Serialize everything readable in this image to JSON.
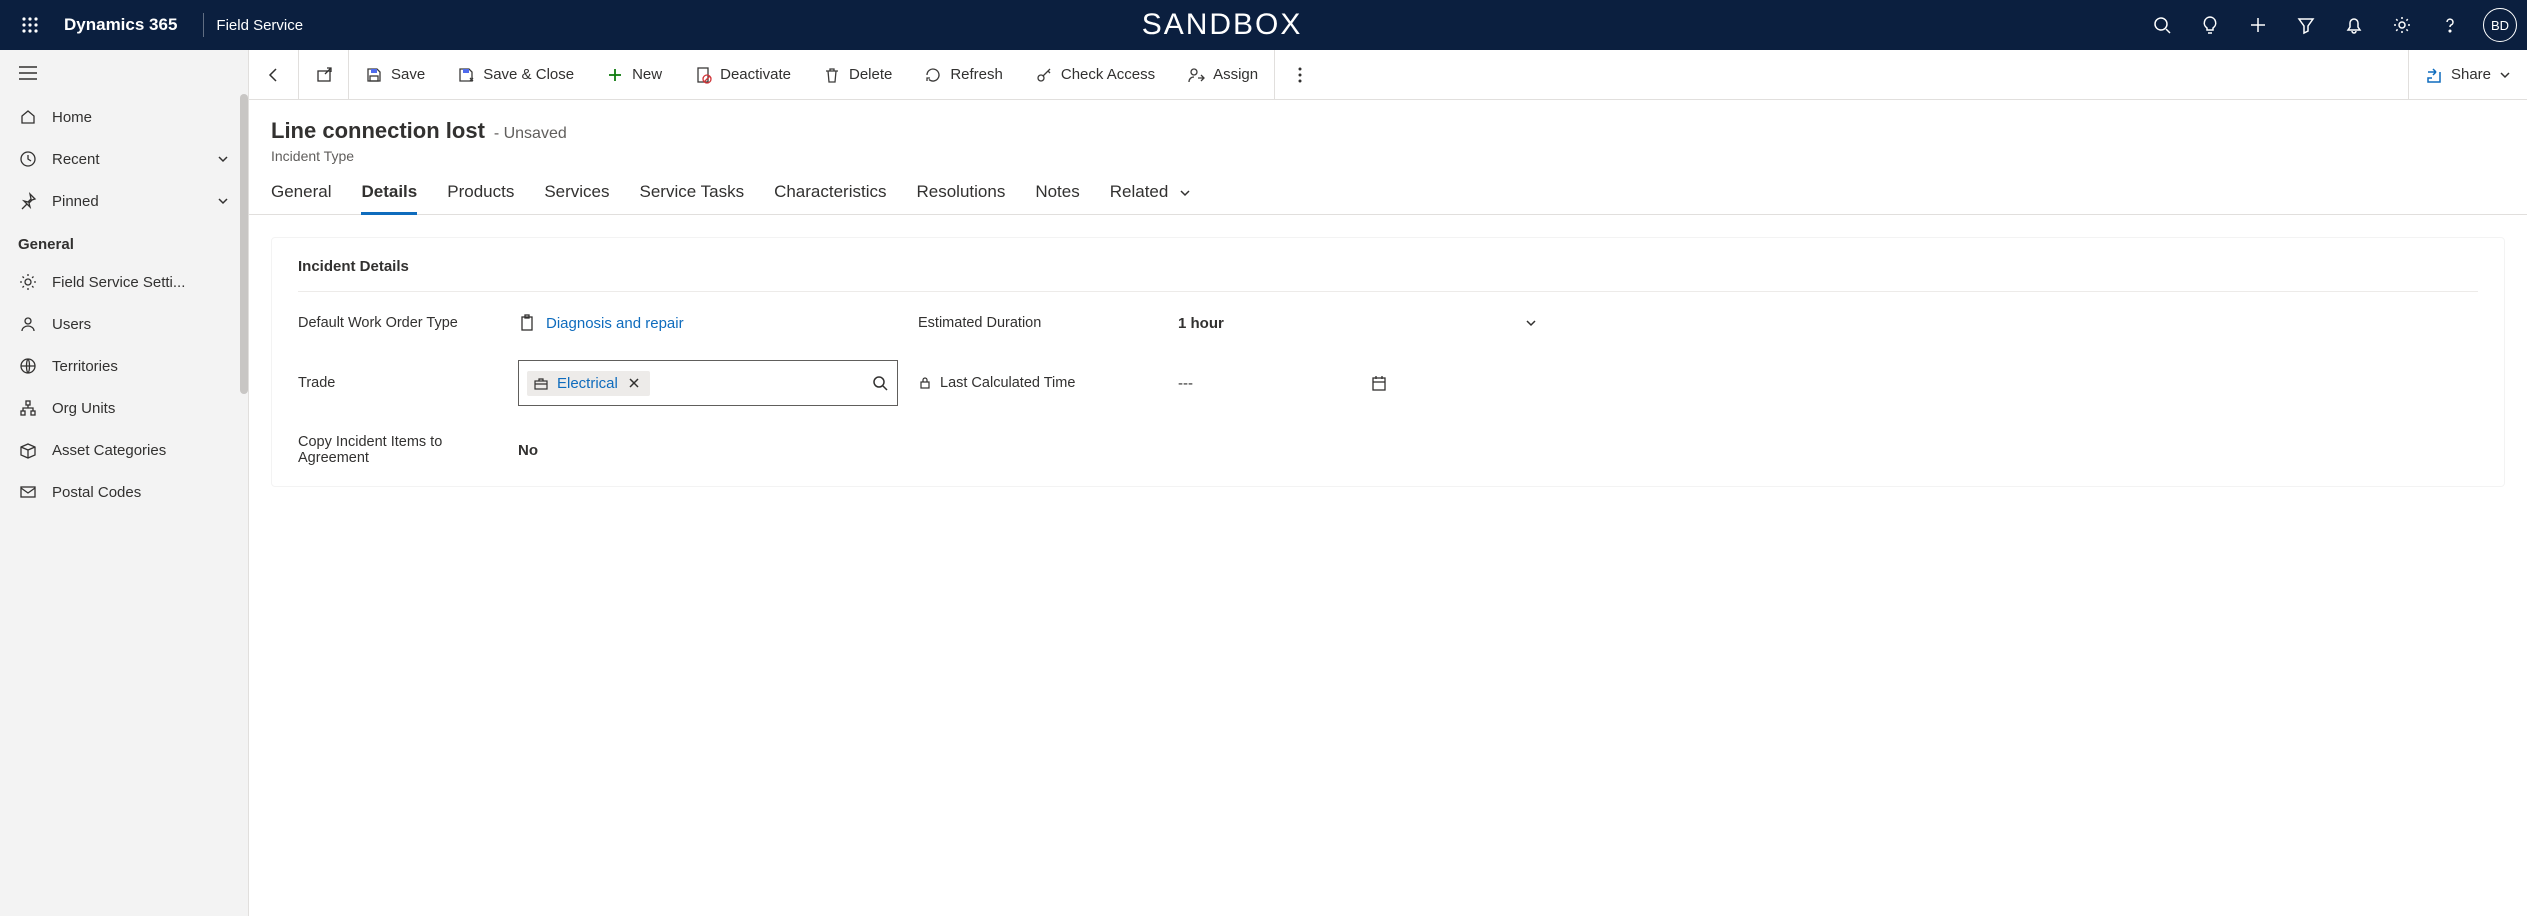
{
  "topbar": {
    "brand": "Dynamics 365",
    "module": "Field Service",
    "center": "SANDBOX",
    "avatar": "BD"
  },
  "sidebar": {
    "home": "Home",
    "recent": "Recent",
    "pinned": "Pinned",
    "section": "General",
    "items": {
      "fss": "Field Service Setti...",
      "users": "Users",
      "territories": "Territories",
      "orgunits": "Org Units",
      "assetcat": "Asset Categories",
      "postal": "Postal Codes"
    }
  },
  "cmdbar": {
    "save": "Save",
    "saveclose": "Save & Close",
    "new": "New",
    "deactivate": "Deactivate",
    "delete": "Delete",
    "refresh": "Refresh",
    "checkaccess": "Check Access",
    "assign": "Assign",
    "share": "Share"
  },
  "header": {
    "title": "Line connection lost",
    "status": "- Unsaved",
    "sub": "Incident Type"
  },
  "tabs": {
    "general": "General",
    "details": "Details",
    "products": "Products",
    "services": "Services",
    "servicetasks": "Service Tasks",
    "characteristics": "Characteristics",
    "resolutions": "Resolutions",
    "notes": "Notes",
    "related": "Related"
  },
  "card": {
    "title": "Incident Details",
    "workorder_lbl": "Default Work Order Type",
    "workorder_val": "Diagnosis and repair",
    "trade_lbl": "Trade",
    "trade_val": "Electrical",
    "copy_lbl": "Copy Incident Items to Agreement",
    "copy_val": "No",
    "estdur_lbl": "Estimated Duration",
    "estdur_val": "1 hour",
    "lastcalc_lbl": "Last Calculated Time",
    "lastcalc_val": "---"
  }
}
